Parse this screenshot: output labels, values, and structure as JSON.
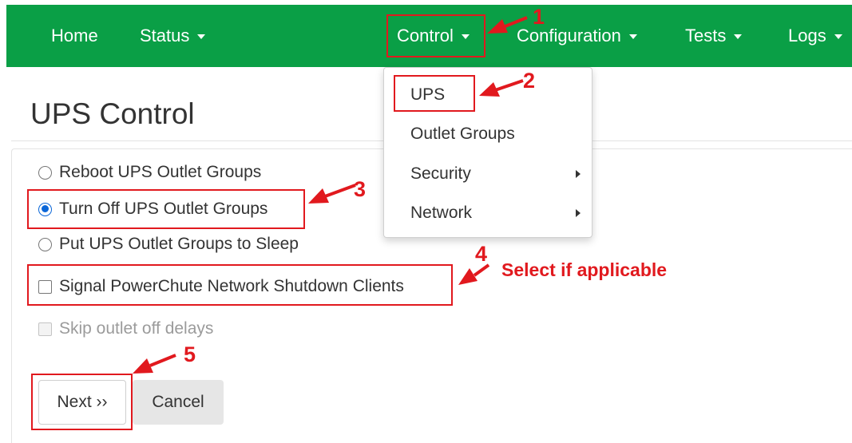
{
  "navbar": {
    "items": [
      {
        "label": "Home",
        "has_caret": false
      },
      {
        "label": "Status",
        "has_caret": true
      },
      {
        "label": "Control",
        "has_caret": true
      },
      {
        "label": "Configuration",
        "has_caret": true
      },
      {
        "label": "Tests",
        "has_caret": true
      },
      {
        "label": "Logs",
        "has_caret": true
      }
    ]
  },
  "dropdown": {
    "items": [
      {
        "label": "UPS",
        "has_submenu": false
      },
      {
        "label": "Outlet Groups",
        "has_submenu": false
      },
      {
        "label": "Security",
        "has_submenu": true
      },
      {
        "label": "Network",
        "has_submenu": true
      }
    ]
  },
  "page": {
    "title": "UPS Control"
  },
  "form": {
    "radios": [
      {
        "label": "Reboot UPS Outlet Groups",
        "checked": false
      },
      {
        "label": "Turn Off UPS Outlet Groups",
        "checked": true
      },
      {
        "label": "Put UPS Outlet Groups to Sleep",
        "checked": false
      }
    ],
    "signal_label": "Signal PowerChute Network Shutdown Clients",
    "skip_label": "Skip outlet off delays",
    "next_label": "Next ››",
    "cancel_label": "Cancel"
  },
  "annotations": {
    "steps": [
      "1",
      "2",
      "3",
      "4",
      "5"
    ],
    "note": "Select if applicable"
  },
  "colors": {
    "navbar": "#0a9f46",
    "annotation": "#e1191e",
    "radio_accent": "#0a66d8"
  }
}
